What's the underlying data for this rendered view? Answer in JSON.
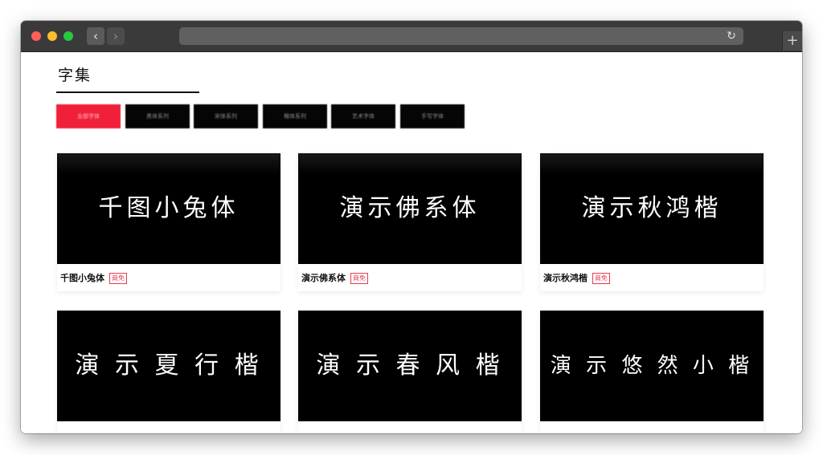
{
  "browser": {
    "back_glyph": "‹",
    "forward_glyph": "›",
    "reload_glyph": "↻",
    "new_tab_glyph": "+"
  },
  "page": {
    "title": "字集"
  },
  "tabs": [
    {
      "label": "全部字体",
      "active": true
    },
    {
      "label": "黑体系列",
      "active": false
    },
    {
      "label": "宋体系列",
      "active": false
    },
    {
      "label": "楷体系列",
      "active": false
    },
    {
      "label": "艺术字体",
      "active": false
    },
    {
      "label": "手写字体",
      "active": false
    }
  ],
  "fonts": [
    {
      "sample": "千图小兔体",
      "name": "千图小兔体",
      "badge": "商免"
    },
    {
      "sample": "演示佛系体",
      "name": "演示佛系体",
      "badge": "商免"
    },
    {
      "sample": "演示秋鸿楷",
      "name": "演示秋鸿楷",
      "badge": "商免"
    },
    {
      "sample": "演 示 夏 行 楷",
      "name": "",
      "badge": ""
    },
    {
      "sample": "演 示 春 风 楷",
      "name": "",
      "badge": ""
    },
    {
      "sample": "演 示 悠 然 小 楷",
      "name": "",
      "badge": ""
    }
  ],
  "colors": {
    "accent": "#f0203a",
    "card_preview_bg": "#000000"
  }
}
